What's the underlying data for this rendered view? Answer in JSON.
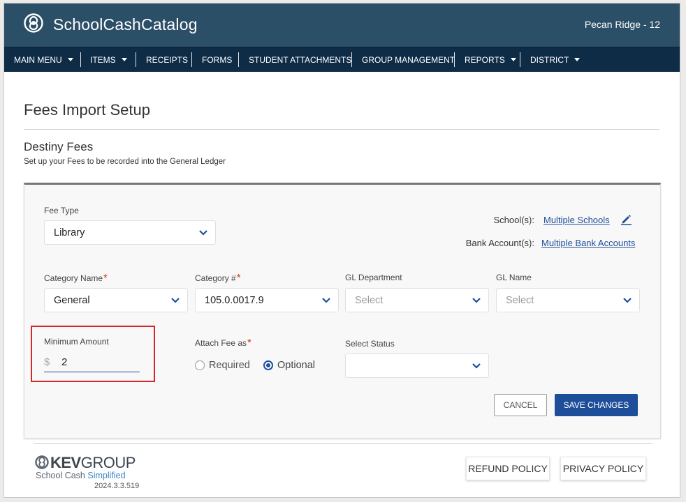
{
  "header": {
    "brand": "SchoolCashCatalog",
    "school": "Pecan Ridge - 12"
  },
  "nav": {
    "items": [
      {
        "label": "MAIN MENU",
        "has_dropdown": true
      },
      {
        "label": "ITEMS",
        "has_dropdown": true
      },
      {
        "label": "RECEIPTS",
        "has_dropdown": false
      },
      {
        "label": "FORMS",
        "has_dropdown": false
      },
      {
        "label": "STUDENT ATTACHMENTS",
        "has_dropdown": false
      },
      {
        "label": "GROUP MANAGEMENT",
        "has_dropdown": false
      },
      {
        "label": "REPORTS",
        "has_dropdown": true
      },
      {
        "label": "DISTRICT",
        "has_dropdown": true
      }
    ]
  },
  "page": {
    "title": "Fees Import Setup",
    "section_title": "Destiny Fees",
    "section_subtitle": "Set up your Fees to be recorded into the General Ledger"
  },
  "form": {
    "fee_type": {
      "label": "Fee Type",
      "value": "Library"
    },
    "schools": {
      "label": "School(s):",
      "value": "Multiple Schools"
    },
    "bank_accounts": {
      "label": "Bank Account(s):",
      "value": "Multiple Bank Accounts"
    },
    "category_name": {
      "label": "Category Name",
      "value": "General"
    },
    "category_number": {
      "label": "Category #",
      "value": "105.0.0017.9"
    },
    "gl_department": {
      "label": "GL Department",
      "placeholder": "Select"
    },
    "gl_name": {
      "label": "GL Name",
      "placeholder": "Select"
    },
    "minimum_amount": {
      "label": "Minimum Amount",
      "currency": "$",
      "value": "2"
    },
    "attach_fee": {
      "label": "Attach Fee as",
      "options": [
        "Required",
        "Optional"
      ],
      "selected": "Optional"
    },
    "select_status": {
      "label": "Select Status",
      "value": ""
    },
    "required_marker": "*"
  },
  "actions": {
    "cancel": "CANCEL",
    "save": "SAVE CHANGES"
  },
  "footer": {
    "logo_main": "KEVGROUP",
    "logo_kev": "KEV",
    "logo_group": "GROUP",
    "tagline_a": "School Cash",
    "tagline_b": "Simplified",
    "version": "2024.3.3.519",
    "refund": "REFUND POLICY",
    "privacy": "PRIVACY POLICY"
  },
  "colors": {
    "header_bg": "#2c4f68",
    "nav_bg": "#0f2c47",
    "primary": "#1e4e9a",
    "required": "#d9321b",
    "highlight": "#d3282d"
  }
}
